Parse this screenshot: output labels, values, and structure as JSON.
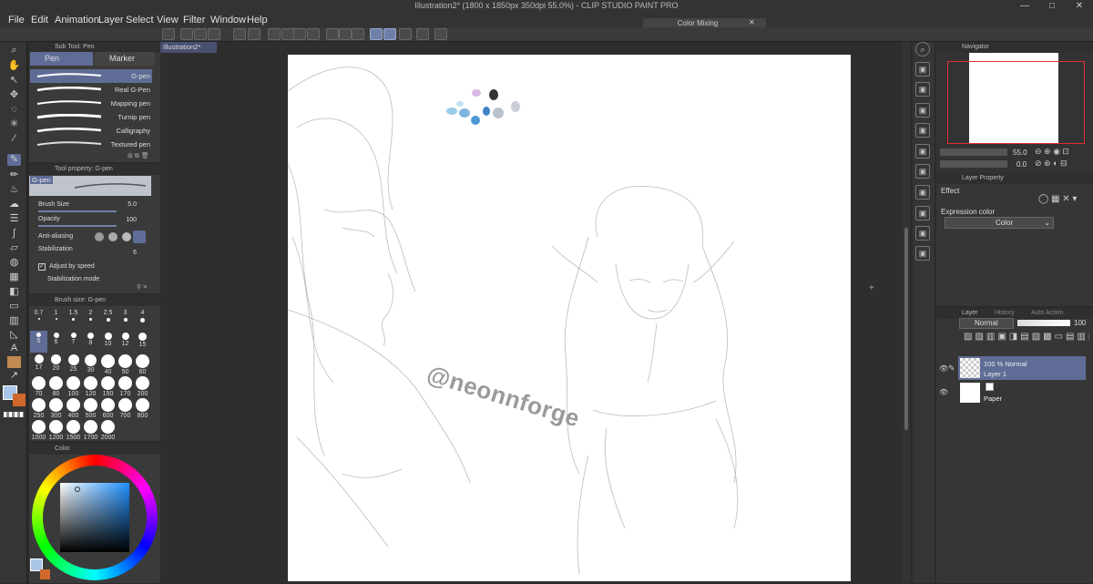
{
  "window": {
    "title": "Illustration2* (1800 x 1850px 350dpi 55.0%) - CLIP STUDIO PAINT PRO",
    "controls": [
      "—",
      "□",
      "✕"
    ]
  },
  "menu": [
    "File",
    "Edit",
    "Animation",
    "Layer",
    "Select",
    "View",
    "Filter",
    "Window",
    "Help"
  ],
  "color_mixing": {
    "title": "Color Mixing"
  },
  "subtool_panel": {
    "title": "Sub Tool: Pen",
    "tabs": [
      "Pen",
      "Marker"
    ],
    "brushes": [
      "G-pen",
      "Real G-Pen",
      "Mapping pen",
      "Turnip pen",
      "Calligraphy",
      "Textured pen"
    ],
    "selected": "G-pen"
  },
  "tool_property": {
    "title": "Tool property: G-pen",
    "preset_name": "G-pen",
    "brush_size_label": "Brush Size",
    "brush_size_value": "5.0",
    "opacity_label": "Opacity",
    "opacity_value": "100",
    "antialias_label": "Anti-aliasing",
    "stabilization_label": "Stabilization",
    "stabilization_value": "6",
    "adjust_speed_label": "Adjust by speed",
    "stab_mode_label": "Stabilization mode"
  },
  "brush_size_panel": {
    "title": "Brush size: G-pen",
    "sizes": [
      "0.7",
      "1",
      "1.5",
      "2",
      "2.5",
      "3",
      "4",
      "5",
      "6",
      "7",
      "8",
      "10",
      "12",
      "15",
      "17",
      "20",
      "25",
      "30",
      "40",
      "50",
      "60",
      "70",
      "80",
      "100",
      "120",
      "150",
      "170",
      "200",
      "250",
      "300",
      "400",
      "500",
      "600",
      "700",
      "800",
      "1000",
      "1200",
      "1500",
      "1700",
      "2000"
    ],
    "selected": "5"
  },
  "color_panel": {
    "title": "Color"
  },
  "document": {
    "tab_label": "Illustration2*",
    "watermark": "@neonnforge"
  },
  "navigator": {
    "title": "Navigator",
    "zoom": "55.0",
    "rotation": "0.0"
  },
  "layer_property": {
    "title": "Layer Property",
    "effect_label": "Effect",
    "expression_label": "Expression color",
    "expression_value": "Color"
  },
  "layer_panel": {
    "tabs": [
      "Layer",
      "History",
      "Auto Action"
    ],
    "blend_mode": "Normal",
    "opacity": "100",
    "layers": [
      {
        "info": "100 % Normal",
        "name": "Layer 1",
        "selected": true
      },
      {
        "info": "",
        "name": "Paper",
        "selected": false
      }
    ]
  },
  "colors": {
    "accent": "#5f6d96",
    "canvas_bg": "#2e2e2e",
    "panel": "#3a3a3a",
    "main_color": "#a9c6e8",
    "sub_color": "#d0692a"
  }
}
